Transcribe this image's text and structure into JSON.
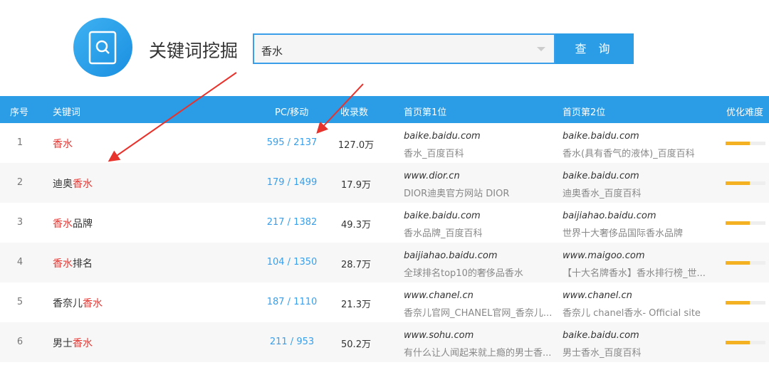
{
  "header": {
    "title": "关键词挖掘",
    "search_value": "香水",
    "search_button": "查 询"
  },
  "columns": [
    "序号",
    "关键词",
    "PC/移动",
    "收录数",
    "首页第1位",
    "首页第2位",
    "优化难度"
  ],
  "rows": [
    {
      "n": "1",
      "pre": "",
      "hl": "香水",
      "post": "",
      "pc": "595 / 2137",
      "count": "127.0万",
      "d1": "baike.baidu.com",
      "t1": "香水_百度百科",
      "d2": "baike.baidu.com",
      "t2": "香水(具有香气的液体)_百度百科",
      "difficulty": 0.6
    },
    {
      "n": "2",
      "pre": "迪奥",
      "hl": "香水",
      "post": "",
      "pc": "179 / 1499",
      "count": "17.9万",
      "d1": "www.dior.cn",
      "t1": "DIOR迪奥官方网站 DIOR",
      "d2": "baike.baidu.com",
      "t2": "迪奥香水_百度百科",
      "difficulty": 0.6
    },
    {
      "n": "3",
      "pre": "",
      "hl": "香水",
      "post": "品牌",
      "pc": "217 / 1382",
      "count": "49.3万",
      "d1": "baike.baidu.com",
      "t1": "香水品牌_百度百科",
      "d2": "baijiahao.baidu.com",
      "t2": "世界十大奢侈品国际香水品牌",
      "difficulty": 0.6
    },
    {
      "n": "4",
      "pre": "",
      "hl": "香水",
      "post": "排名",
      "pc": "104 / 1350",
      "count": "28.7万",
      "d1": "baijiahao.baidu.com",
      "t1": "全球排名top10的奢侈品香水",
      "d2": "www.maigoo.com",
      "t2": "【十大名牌香水】香水排行榜_世...",
      "difficulty": 0.6
    },
    {
      "n": "5",
      "pre": "香奈儿",
      "hl": "香水",
      "post": "",
      "pc": "187 / 1110",
      "count": "21.3万",
      "d1": "www.chanel.cn",
      "t1": "香奈儿官网_CHANEL官网_香奈儿...",
      "d2": "www.chanel.cn",
      "t2": "香奈儿 chanel香水- Official site",
      "difficulty": 0.6
    },
    {
      "n": "6",
      "pre": "男士",
      "hl": "香水",
      "post": "",
      "pc": "211 / 953",
      "count": "50.2万",
      "d1": "www.sohu.com",
      "t1": "有什么让人闻起来就上瘾的男士香...",
      "d2": "baike.baidu.com",
      "t2": "男士香水_百度百科",
      "difficulty": 0.6
    }
  ]
}
